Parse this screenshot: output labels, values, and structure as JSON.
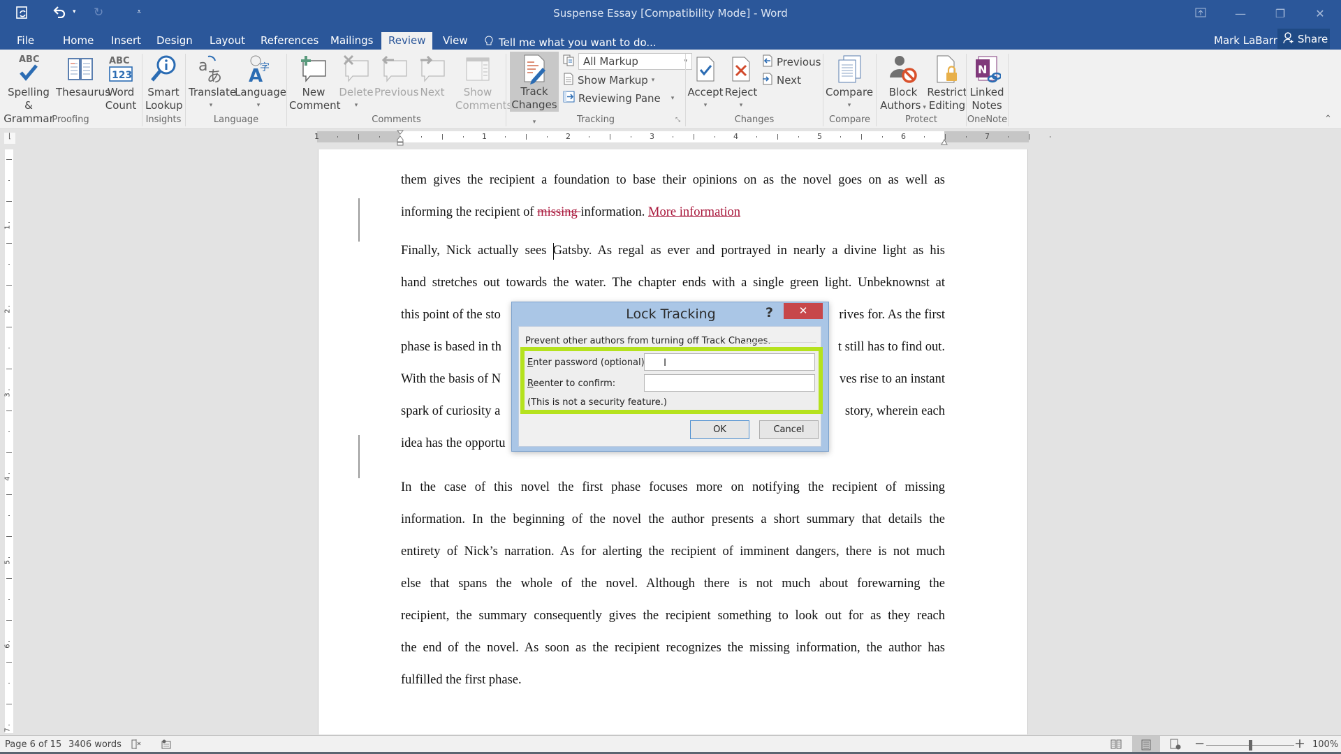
{
  "window": {
    "title": "Suspense Essay [Compatibility Mode] - Word",
    "controls": [
      "ribbon-display-options",
      "minimize",
      "restore",
      "close"
    ]
  },
  "qat": {
    "save_icon": "autosave",
    "undo_icon": "undo",
    "redo_icon": "redo",
    "customize_icon": "customize"
  },
  "tabs": [
    {
      "label": "File"
    },
    {
      "label": "Home"
    },
    {
      "label": "Insert"
    },
    {
      "label": "Design"
    },
    {
      "label": "Layout"
    },
    {
      "label": "References"
    },
    {
      "label": "Mailings"
    },
    {
      "label": "Review",
      "active": true
    },
    {
      "label": "View"
    }
  ],
  "tell_me": {
    "placeholder": "Tell me what you want to do..."
  },
  "user": {
    "name": "Mark LaBarr",
    "share_label": "Share"
  },
  "ribbon": {
    "groups": {
      "proofing": "Proofing",
      "insights": "Insights",
      "language": "Language",
      "comments": "Comments",
      "tracking": "Tracking",
      "changes": "Changes",
      "compare": "Compare",
      "protect": "Protect",
      "onenote": "OneNote"
    },
    "buttons": {
      "spelling_1": "Spelling &",
      "spelling_2": "Grammar",
      "thesaurus": "Thesaurus",
      "wordcount_1": "Word",
      "wordcount_2": "Count",
      "smart_1": "Smart",
      "smart_2": "Lookup",
      "translate": "Translate",
      "language": "Language",
      "newcomment_1": "New",
      "newcomment_2": "Comment",
      "delete": "Delete",
      "previous": "Previous",
      "next": "Next",
      "showcomments_1": "Show",
      "showcomments_2": "Comments",
      "track_1": "Track",
      "track_2": "Changes",
      "markup_select": "All Markup",
      "show_markup": "Show Markup",
      "reviewing_pane": "Reviewing Pane",
      "accept": "Accept",
      "reject": "Reject",
      "change_prev": "Previous",
      "change_next": "Next",
      "compare": "Compare",
      "block_1": "Block",
      "block_2": "Authors",
      "restrict_1": "Restrict",
      "restrict_2": "Editing",
      "linked_1": "Linked",
      "linked_2": "Notes"
    }
  },
  "ruler": {
    "h_ticks": [
      "1",
      "1",
      "2",
      "3",
      "4",
      "5",
      "6",
      "7"
    ],
    "v_ticks": [
      "1",
      "2",
      "3",
      "4",
      "5",
      "6",
      "7"
    ]
  },
  "document": {
    "lines": [
      {
        "text": "them gives the recipient a foundation to base their opinions on as the novel goes on as well as"
      },
      {
        "pre": "informing the recipient of ",
        "deleted": "missing ",
        "mid": "information. ",
        "inserted": "More information"
      },
      {
        "text": "Finally, Nick actually sees Gatsby. As regal as ever and portrayed in nearly a divine light as his"
      },
      {
        "text": "hand stretches out towards the water. The chapter ends with a single green light. Unbeknownst at"
      },
      {
        "left": "this point of the sto",
        "right": "rives for. As the first"
      },
      {
        "left": "phase is based in th",
        "right": "t still has to find out."
      },
      {
        "left": "With the basis of N",
        "right": "ves rise to an instant"
      },
      {
        "left": "spark of curiosity a",
        "right": "story, wherein each"
      },
      {
        "left": "idea has the opportu",
        "right": ""
      }
    ],
    "paragraph3": [
      "In the case of this novel the first phase focuses more on notifying the recipient of missing",
      "information. In the beginning of the novel the author presents a short summary that details the",
      "entirety of Nick’s narration. As for alerting the recipient of imminent dangers, there is not much",
      "else that spans the whole of the novel. Although there is not much about forewarning the",
      "recipient, the summary consequently gives the recipient something to look out for as they reach",
      "the end of the novel. As soon as the recipient recognizes the missing information, the author has",
      "fulfilled the first phase."
    ],
    "colors": {
      "revision": "#a8163a"
    }
  },
  "dialog": {
    "title": "Lock Tracking",
    "help": "?",
    "close": "✕",
    "description": "Prevent other authors from turning off Track Changes.",
    "password_label_key": "E",
    "password_label_rest": "nter password (optional):",
    "password_value": "",
    "confirm_label_key": "R",
    "confirm_label_rest": "eenter to confirm:",
    "confirm_value": "",
    "note": "(This is not a security feature.)",
    "ok": "OK",
    "cancel": "Cancel",
    "highlight_color": "#b5e21e"
  },
  "status": {
    "page": "Page 6 of 15",
    "words": "3406 words",
    "zoom": "100%",
    "zoom_level_percent": 100
  }
}
